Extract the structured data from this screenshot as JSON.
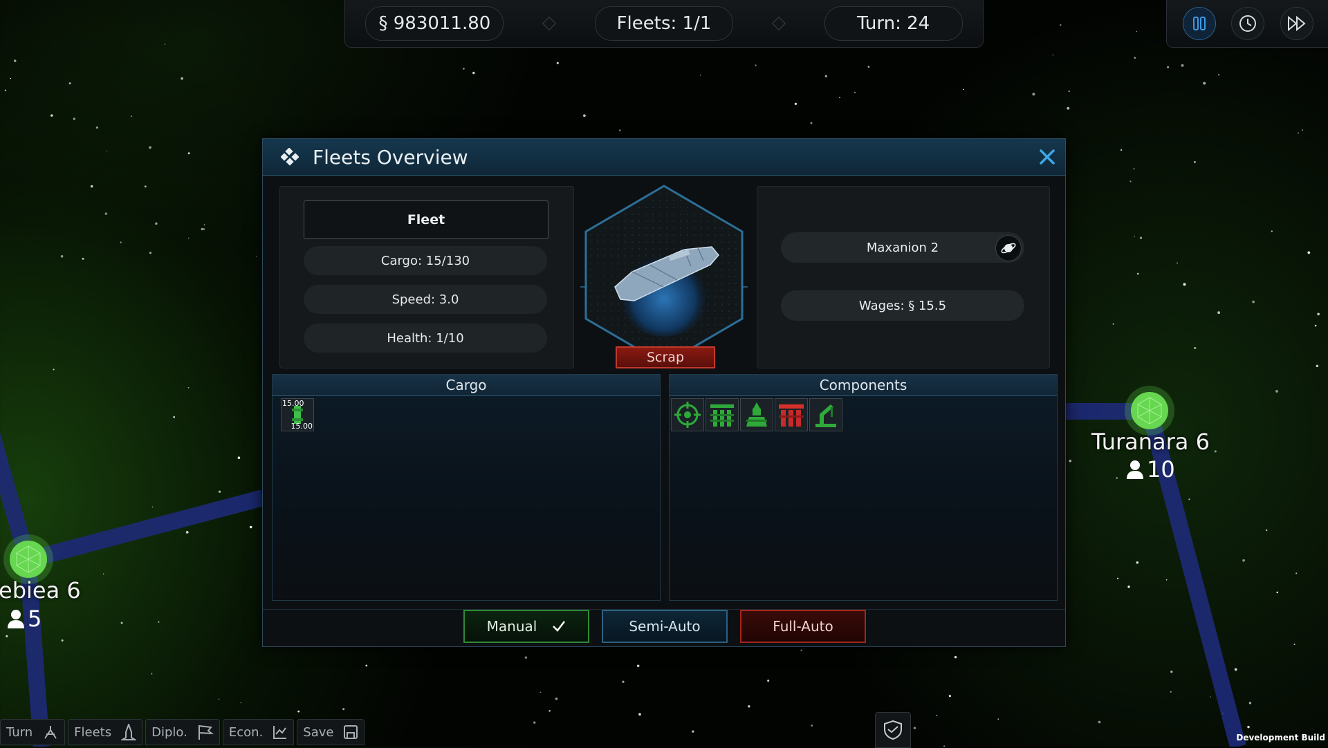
{
  "resources": {
    "money": "§ 983011.80",
    "fleets": "Fleets: 1/1",
    "turn": "Turn: 24"
  },
  "time_controls": {
    "pause_icon": "pause-icon",
    "speed_icon": "clock-icon",
    "fast_forward_icon": "fast-forward-icon"
  },
  "map": {
    "planets": [
      {
        "name": "Turanara 6",
        "population": "10"
      },
      {
        "name": "ebiea 6",
        "population": "5"
      }
    ]
  },
  "window": {
    "title": "Fleets Overview",
    "fleet_name": "Fleet",
    "stats": {
      "cargo": "Cargo: 15/130",
      "speed": "Speed: 3.0",
      "health": "Health: 1/10"
    },
    "scrap_label": "Scrap",
    "location": "Maxanion 2",
    "wages": "Wages: § 15.5",
    "cargo_header": "Cargo",
    "components_header": "Components",
    "cargo_items": [
      {
        "top": "15.00",
        "bottom": "15.00",
        "color": "#3fbf4a"
      }
    ],
    "components": [
      {
        "icon": "targeting-icon",
        "color": "#2a8a35"
      },
      {
        "icon": "cargo-module-icon",
        "color": "#2a8a35"
      },
      {
        "icon": "engine-icon",
        "color": "#2a8a35"
      },
      {
        "icon": "armor-module-icon",
        "color": "#c82a2a"
      },
      {
        "icon": "crane-icon",
        "color": "#2a8a35"
      }
    ],
    "modes": {
      "manual": "Manual",
      "semi": "Semi-Auto",
      "full": "Full-Auto"
    }
  },
  "bottom_bar": {
    "turn": "Turn",
    "fleets": "Fleets",
    "diplo": "Diplo.",
    "econ": "Econ.",
    "save": "Save"
  },
  "dev_label": "Development Build",
  "colors": {
    "accent_blue": "#2b6184",
    "accent_green": "#2f8a37",
    "accent_red": "#a5261b",
    "planet_green": "#5fd64a"
  }
}
